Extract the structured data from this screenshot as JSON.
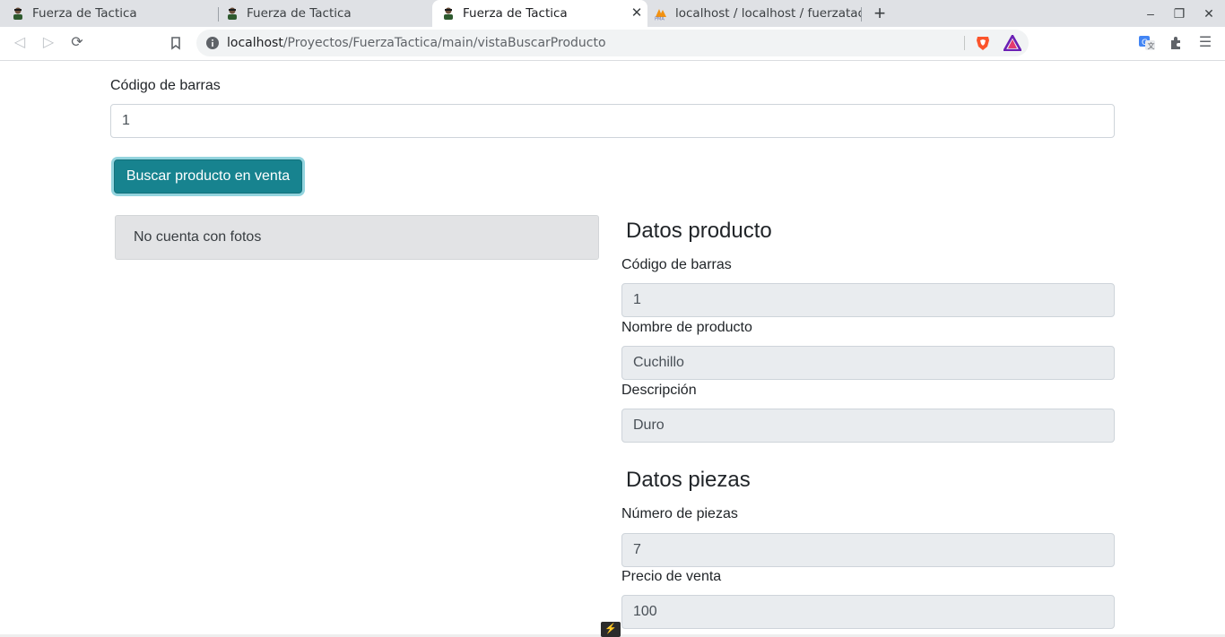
{
  "browser": {
    "tabs": [
      {
        "title": "Fuerza de Tactica",
        "active": false
      },
      {
        "title": "Fuerza de Tactica",
        "active": false
      },
      {
        "title": "Fuerza de Tactica",
        "active": true
      },
      {
        "title": "localhost / localhost / fuerzatac",
        "active": false
      }
    ],
    "url_host": "localhost",
    "url_path": "/Proyectos/FuerzaTactica/main/vistaBuscarProducto"
  },
  "search": {
    "barcode_label": "Código de barras",
    "barcode_value": "1",
    "button_label": "Buscar producto en venta"
  },
  "photos": {
    "no_photos_text": "No cuenta con fotos"
  },
  "product": {
    "heading": "Datos producto",
    "barcode_label": "Código de barras",
    "barcode_value": "1",
    "name_label": "Nombre de producto",
    "name_value": "Cuchillo",
    "description_label": "Descripción",
    "description_value": "Duro"
  },
  "pieces": {
    "heading": "Datos piezas",
    "count_label": "Número de piezas",
    "count_value": "7",
    "price_label": "Precio de venta",
    "price_value": "100"
  },
  "colors": {
    "button_primary": "#17838f",
    "readonly_bg": "#e9ecef",
    "alert_bg": "#e2e3e5"
  }
}
